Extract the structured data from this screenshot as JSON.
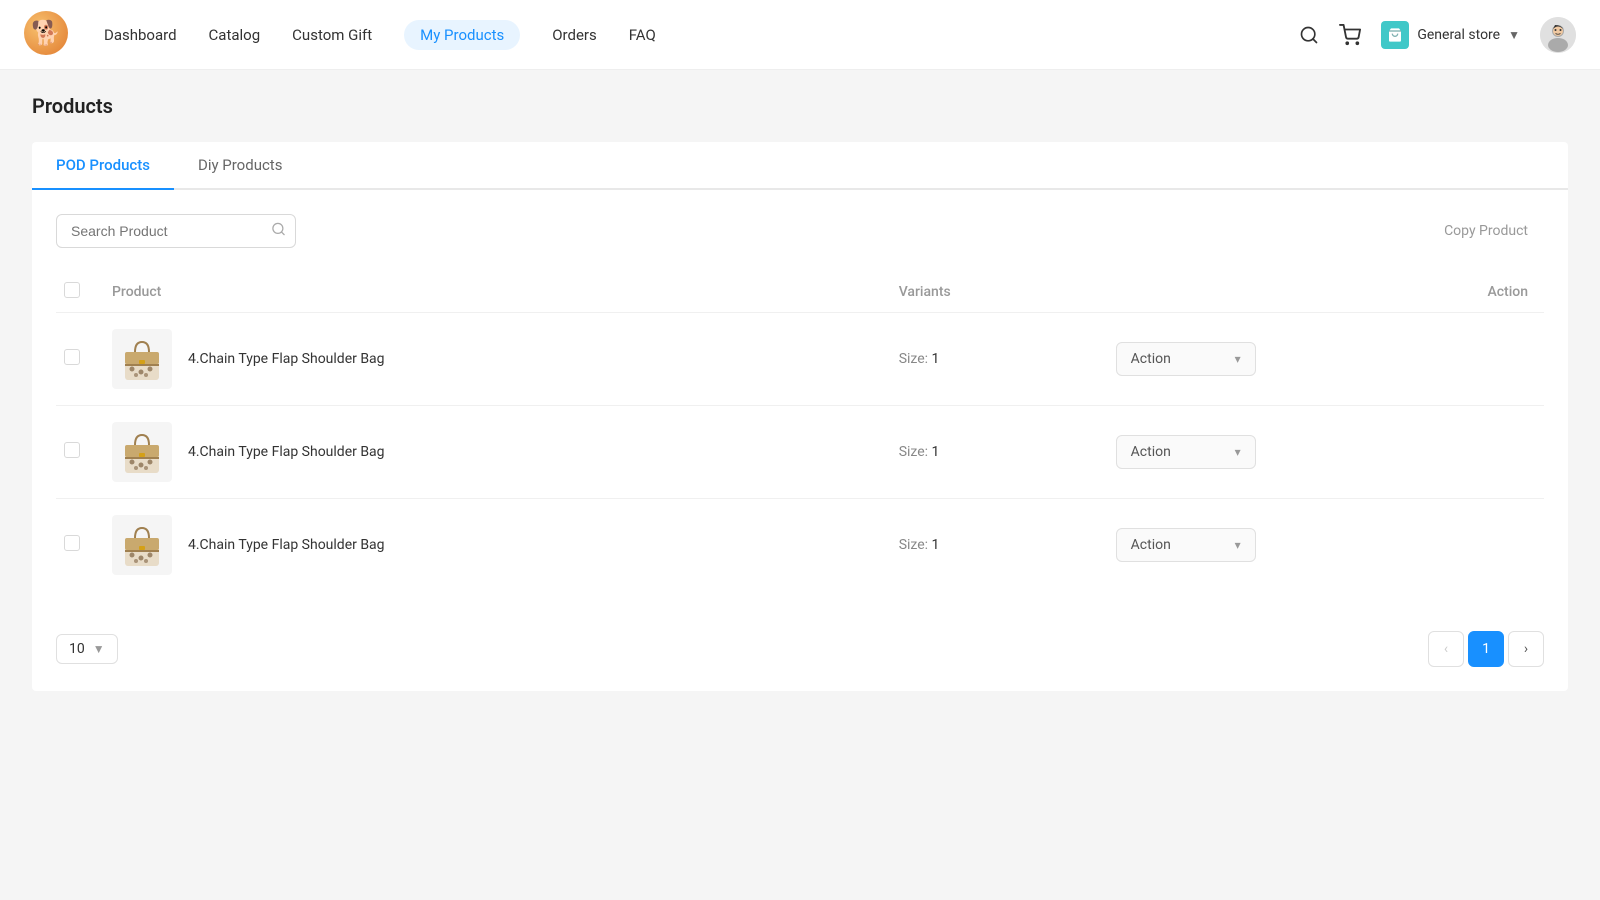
{
  "header": {
    "nav_items": [
      {
        "label": "Dashboard",
        "active": false
      },
      {
        "label": "Catalog",
        "active": false
      },
      {
        "label": "Custom Gift",
        "active": false
      },
      {
        "label": "My Products",
        "active": true
      },
      {
        "label": "Orders",
        "active": false
      },
      {
        "label": "FAQ",
        "active": false
      }
    ],
    "store_name": "General store",
    "store_icon": "🛍"
  },
  "page": {
    "title": "Products"
  },
  "tabs": [
    {
      "label": "POD Products",
      "active": true
    },
    {
      "label": "Diy Products",
      "active": false
    }
  ],
  "toolbar": {
    "search_placeholder": "Search Product",
    "copy_product_label": "Copy Product"
  },
  "table": {
    "columns": [
      "",
      "Product",
      "Variants",
      "Action"
    ],
    "rows": [
      {
        "product_name": "4.Chain Type Flap Shoulder Bag",
        "variants_label": "Size:",
        "variants_value": "1",
        "action_label": "Action"
      },
      {
        "product_name": "4.Chain Type Flap Shoulder Bag",
        "variants_label": "Size:",
        "variants_value": "1",
        "action_label": "Action"
      },
      {
        "product_name": "4.Chain Type Flap Shoulder Bag",
        "variants_label": "Size:",
        "variants_value": "1",
        "action_label": "Action"
      }
    ]
  },
  "pagination": {
    "page_size": "10",
    "current_page": 1,
    "prev_label": "‹",
    "next_label": "›"
  },
  "colors": {
    "accent": "#1890ff",
    "tab_active": "#1890ff"
  }
}
